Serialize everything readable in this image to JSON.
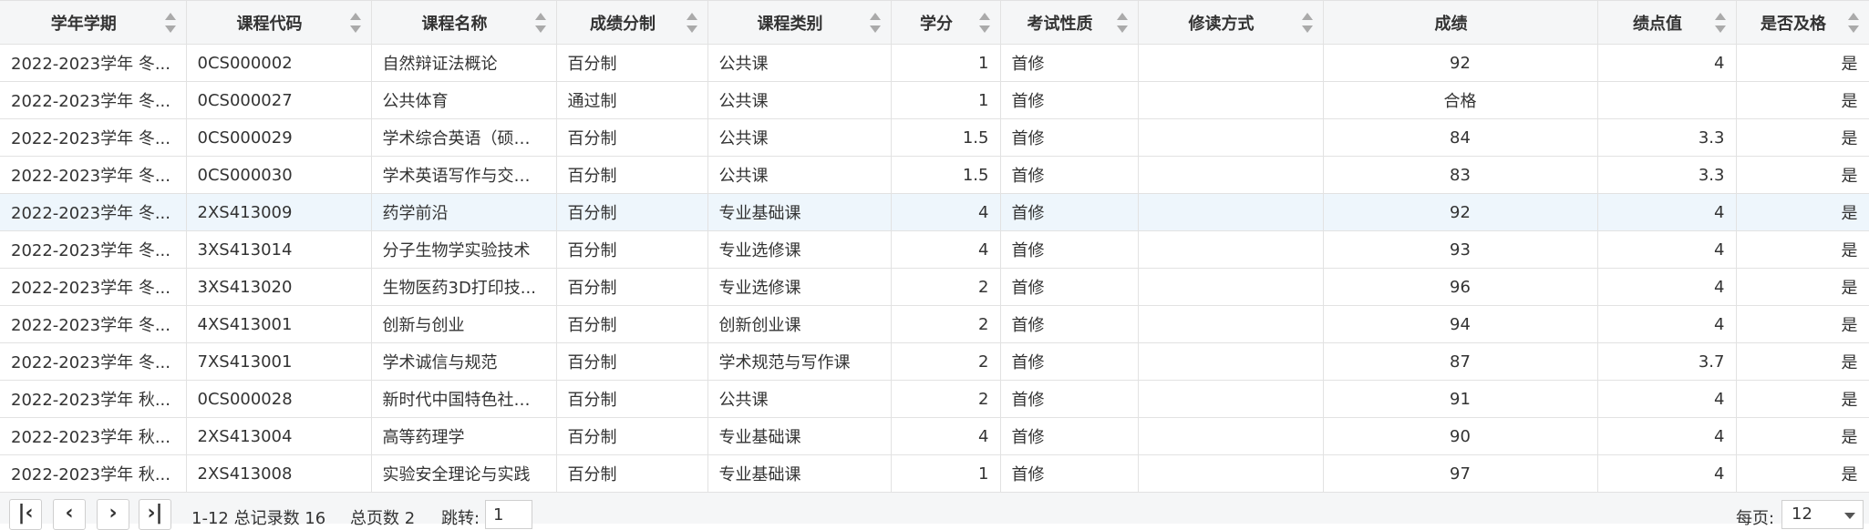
{
  "table": {
    "columns": [
      "学年学期",
      "课程代码",
      "课程名称",
      "成绩分制",
      "课程类别",
      "学分",
      "考试性质",
      "修读方式",
      "成绩",
      "绩点值",
      "是否及格"
    ],
    "rows": [
      [
        "2022-2023学年 冬...",
        "0CS000002",
        "自然辩证法概论",
        "百分制",
        "公共课",
        "1",
        "首修",
        "",
        "92",
        "4",
        "是"
      ],
      [
        "2022-2023学年 冬...",
        "0CS000027",
        "公共体育",
        "通过制",
        "公共课",
        "1",
        "首修",
        "",
        "合格",
        "",
        "是"
      ],
      [
        "2022-2023学年 冬...",
        "0CS000029",
        "学术综合英语（硕士...",
        "百分制",
        "公共课",
        "1.5",
        "首修",
        "",
        "84",
        "3.3",
        "是"
      ],
      [
        "2022-2023学年 冬...",
        "0CS000030",
        "学术英语写作与交流...",
        "百分制",
        "公共课",
        "1.5",
        "首修",
        "",
        "83",
        "3.3",
        "是"
      ],
      [
        "2022-2023学年 冬...",
        "2XS413009",
        "药学前沿",
        "百分制",
        "专业基础课",
        "4",
        "首修",
        "",
        "92",
        "4",
        "是"
      ],
      [
        "2022-2023学年 冬...",
        "3XS413014",
        "分子生物学实验技术",
        "百分制",
        "专业选修课",
        "4",
        "首修",
        "",
        "93",
        "4",
        "是"
      ],
      [
        "2022-2023学年 冬...",
        "3XS413020",
        "生物医药3D打印技...",
        "百分制",
        "专业选修课",
        "2",
        "首修",
        "",
        "96",
        "4",
        "是"
      ],
      [
        "2022-2023学年 冬...",
        "4XS413001",
        "创新与创业",
        "百分制",
        "创新创业课",
        "2",
        "首修",
        "",
        "94",
        "4",
        "是"
      ],
      [
        "2022-2023学年 冬...",
        "7XS413001",
        "学术诚信与规范",
        "百分制",
        "学术规范与写作课",
        "2",
        "首修",
        "",
        "87",
        "3.7",
        "是"
      ],
      [
        "2022-2023学年 秋...",
        "0CS000028",
        "新时代中国特色社会...",
        "百分制",
        "公共课",
        "2",
        "首修",
        "",
        "91",
        "4",
        "是"
      ],
      [
        "2022-2023学年 秋...",
        "2XS413004",
        "高等药理学",
        "百分制",
        "专业基础课",
        "4",
        "首修",
        "",
        "90",
        "4",
        "是"
      ],
      [
        "2022-2023学年 秋...",
        "2XS413008",
        "实验安全理论与实践",
        "百分制",
        "专业基础课",
        "1",
        "首修",
        "",
        "97",
        "4",
        "是"
      ]
    ],
    "selected_row": 4
  },
  "pager": {
    "first_icon": "first-page-icon",
    "prev_icon": "prev-page-icon",
    "next_icon": "next-page-icon",
    "last_icon": "last-page-icon",
    "range_text": "1-12 总记录数 16",
    "total_pages_text": "总页数 2",
    "jump_label": "跳转:",
    "jump_value": "1",
    "page_size_label": "每页:",
    "page_size_value": "12"
  }
}
